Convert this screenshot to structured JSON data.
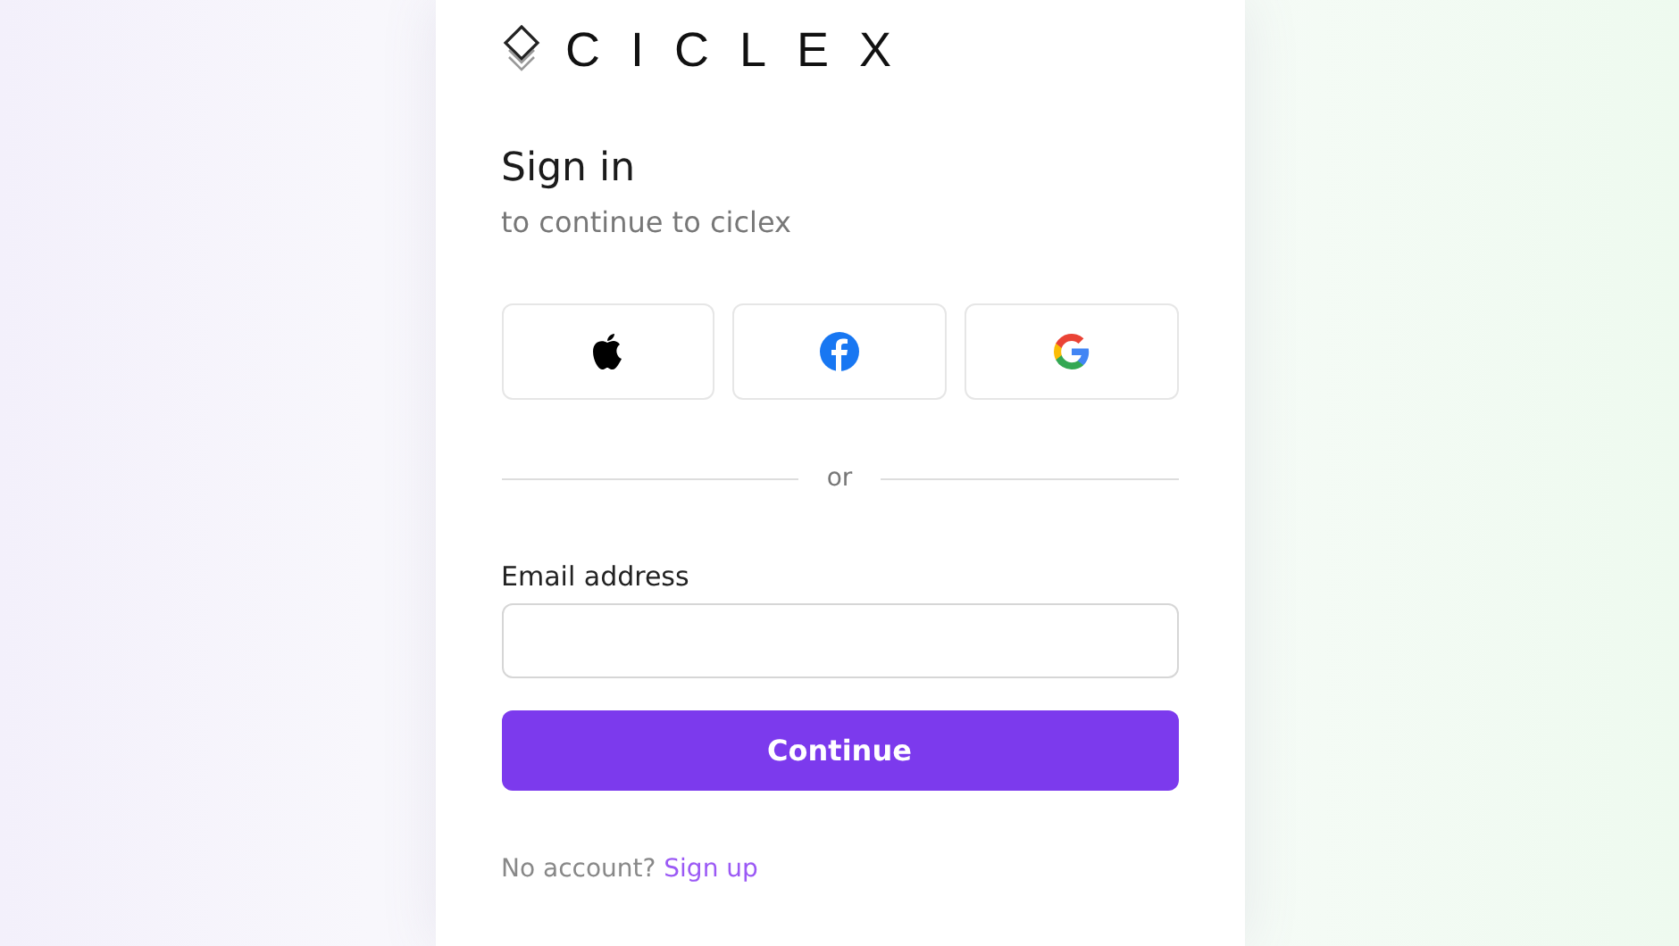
{
  "logo": {
    "text": "CICLEX"
  },
  "heading": "Sign in",
  "subheading": "to continue to ciclex",
  "social_buttons": [
    {
      "kind": "apple"
    },
    {
      "kind": "facebook"
    },
    {
      "kind": "google"
    }
  ],
  "divider": "or",
  "email": {
    "label": "Email address"
  },
  "submit": "Continue",
  "footer": {
    "text": "No account?",
    "link": "Sign up"
  }
}
